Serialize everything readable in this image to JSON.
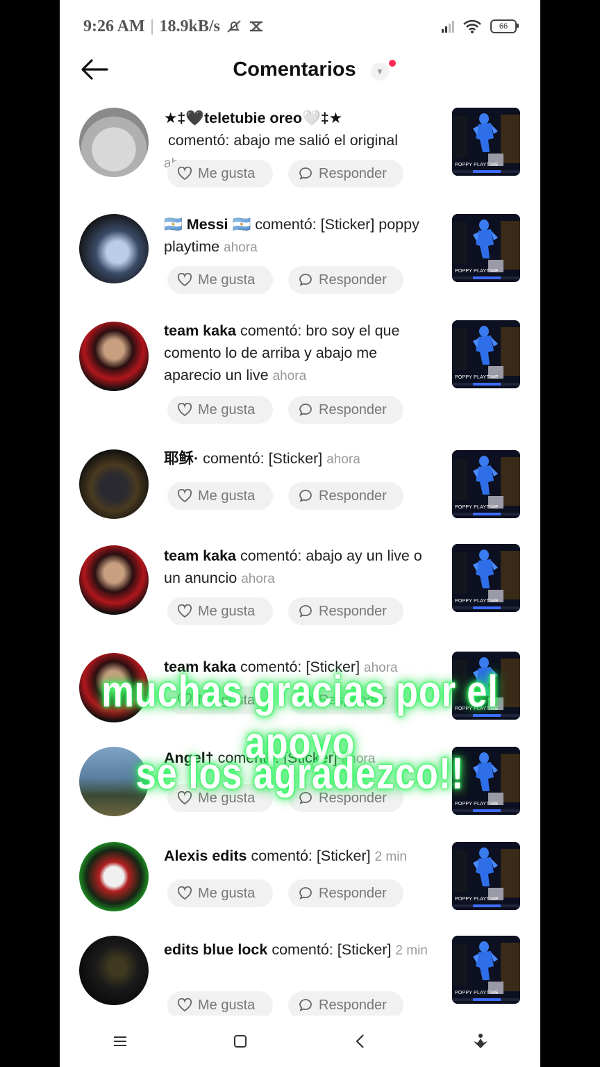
{
  "status_bar": {
    "time": "9:26 AM",
    "separator": "|",
    "speed": "18.9kB/s",
    "battery": "66"
  },
  "header": {
    "title": "Comentarios"
  },
  "comments": [
    {
      "user": "★‡🖤teletubie oreo🤍‡★",
      "verb": " comentó: ",
      "text": "abajo me salió el original",
      "time": "ahora",
      "like_label": "Me gusta",
      "reply_label": "Responder",
      "thumb_caption": "POPPY PLAYTIME"
    },
    {
      "user": "🇦🇷 Messi 🇦🇷",
      "verb": " comentó: ",
      "text": "[Sticker] poppy playtime",
      "time": "ahora",
      "like_label": "Me gusta",
      "reply_label": "Responder",
      "thumb_caption": "POPPY PLAYTIME"
    },
    {
      "user": "team kaka",
      "verb": " comentó: ",
      "text": "bro soy el que comento lo de arriba y abajo me aparecio un live",
      "time": "ahora",
      "like_label": "Me gusta",
      "reply_label": "Responder",
      "thumb_caption": "POPPY PLAYTIME"
    },
    {
      "user": "耶稣·",
      "verb": " comentó: ",
      "text": "[Sticker]",
      "time": "ahora",
      "like_label": "Me gusta",
      "reply_label": "Responder",
      "thumb_caption": "POPPY PLAYTIME"
    },
    {
      "user": "team kaka",
      "verb": " comentó: ",
      "text": "abajo ay un live o un anuncio",
      "time": "ahora",
      "like_label": "Me gusta",
      "reply_label": "Responder",
      "thumb_caption": "POPPY PLAYTIME"
    },
    {
      "user": "team kaka",
      "verb": " comentó: ",
      "text": "[Sticker]",
      "time": "ahora",
      "like_label": "Me gusta",
      "reply_label": "Responder",
      "thumb_caption": "POPPY PLAYTIME"
    },
    {
      "user": "Angel†",
      "verb": " comentó: ",
      "text": "[Sticker]",
      "time": "ahora",
      "like_label": "Me gusta",
      "reply_label": "Responder",
      "thumb_caption": "POPPY PLAYTIME"
    },
    {
      "user": "Alexis edits",
      "verb": " comentó: ",
      "text": "[Sticker]",
      "time": "2 min",
      "like_label": "Me gusta",
      "reply_label": "Responder",
      "thumb_caption": "POPPY PLAYTIME"
    },
    {
      "user": "edits blue lock",
      "verb": " comentó: ",
      "text": "[Sticker]",
      "time": "2 min",
      "like_label": "Me gusta",
      "reply_label": "Responder",
      "thumb_caption": "POPPY PLAYTIME"
    }
  ],
  "overlay": {
    "line1": "muchas gracias por el apoyo",
    "line2": "se los agradezco!!"
  },
  "icons": {
    "back": "back-arrow-icon",
    "like": "heart-icon",
    "reply": "chat-bubble-icon",
    "nav": [
      "menu-icon",
      "home-square-icon",
      "back-chevron-icon",
      "assistant-icon"
    ]
  },
  "colors": {
    "accent_red": "#fe2c55",
    "glow_green": "#33ff66"
  }
}
